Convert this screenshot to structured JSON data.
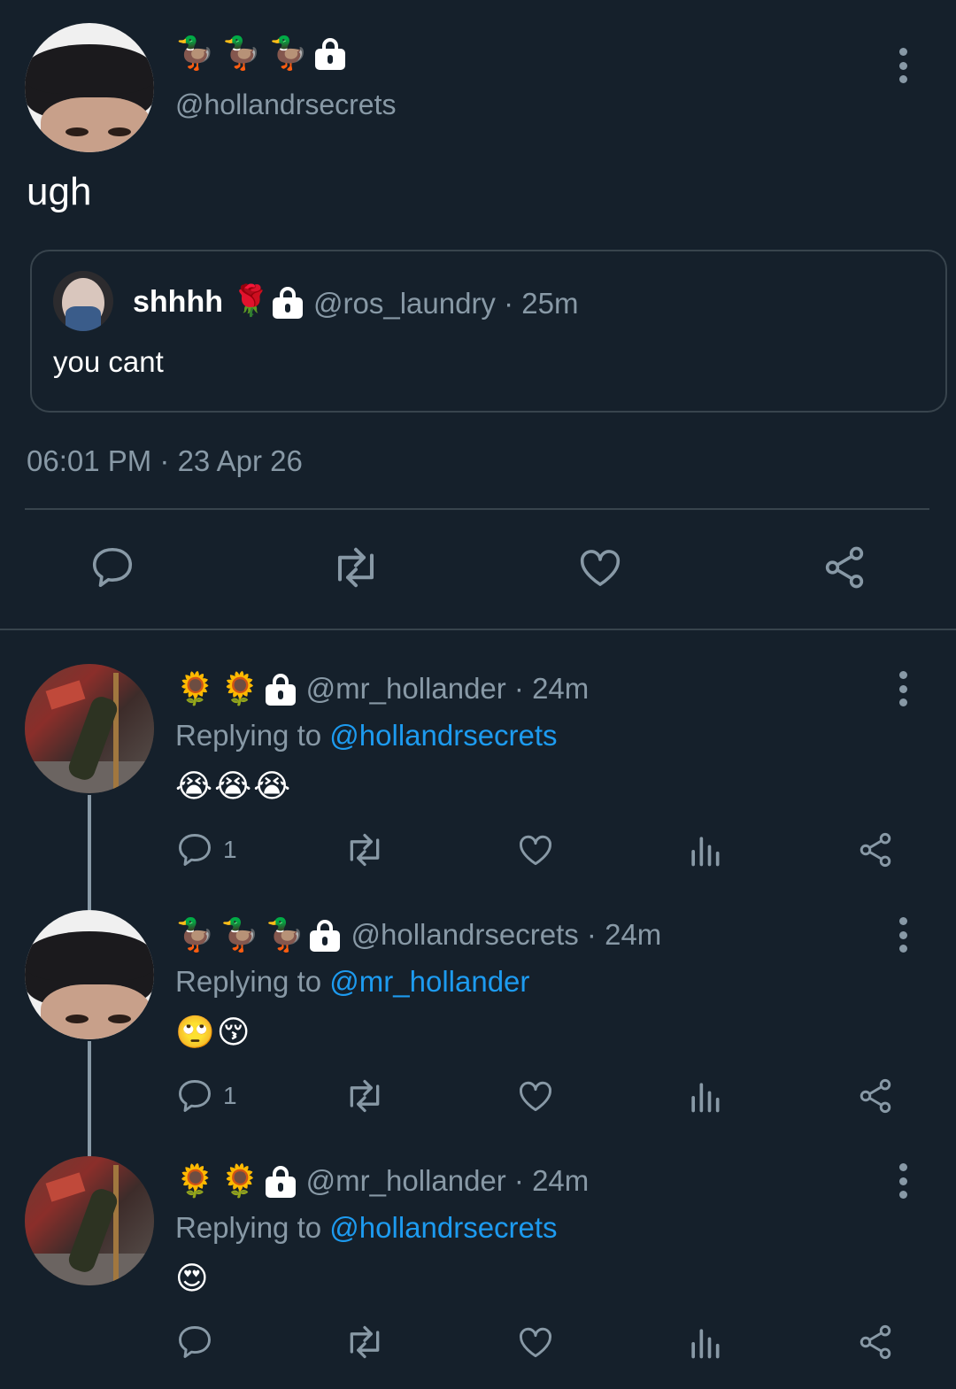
{
  "main_tweet": {
    "name_emojis": [
      "🦆",
      "🦆",
      "🦆"
    ],
    "handle": "@hollandrsecrets",
    "text": "ugh",
    "quote": {
      "name": "shhhh",
      "name_emoji": "🌹",
      "handle_time": "@ros_laundry · 25m",
      "text": "you cant"
    },
    "timestamp": "06:01 PM · 23 Apr 26"
  },
  "replies": [
    {
      "name_emojis": [
        "🌻",
        "🌻"
      ],
      "handle_time": "@mr_hollander · 24m",
      "replying_prefix": "Replying to",
      "replying_to": "@hollandrsecrets",
      "text": "😭😭😭",
      "reply_count": "1"
    },
    {
      "name_emojis": [
        "🦆",
        "🦆",
        "🦆"
      ],
      "handle_time": "@hollandrsecrets · 24m",
      "replying_prefix": "Replying to",
      "replying_to": "@mr_hollander",
      "text": "🙄😚",
      "reply_count": "1"
    },
    {
      "name_emojis": [
        "🌻",
        "🌻"
      ],
      "handle_time": "@mr_hollander · 24m",
      "replying_prefix": "Replying to",
      "replying_to": "@hollandrsecrets",
      "text": "😍",
      "reply_count": ""
    }
  ],
  "icons": {
    "reply": "reply-icon",
    "retweet": "retweet-icon",
    "like": "heart-icon",
    "stats": "stats-icon",
    "share": "share-icon",
    "more": "more-icon",
    "lock": "lock-icon"
  },
  "colors": {
    "background": "#15202b",
    "muted": "#8899a6",
    "link": "#1d9bf0",
    "border": "#38444d"
  }
}
